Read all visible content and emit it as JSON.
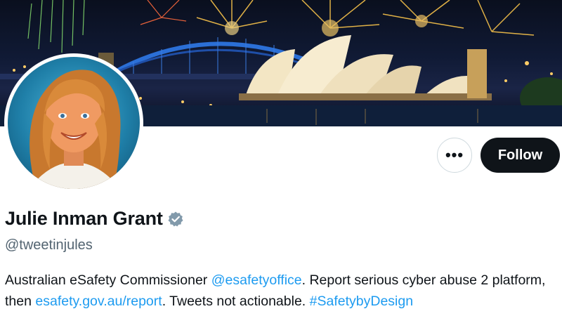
{
  "profile": {
    "display_name": "Julie Inman Grant",
    "handle": "@tweetinjules",
    "verified_icon": "verified-badge-icon",
    "verified_color": "#829aab"
  },
  "actions": {
    "more_label": "•••",
    "more_icon": "more-options-icon",
    "follow_label": "Follow"
  },
  "bio": {
    "text_1": "Australian eSafety Commissioner ",
    "mention": "@esafetyoffice",
    "text_2": ". Report serious cyber abuse 2 platform, then ",
    "link": "esafety.gov.au/report",
    "text_3": ". Tweets not actionable. ",
    "hashtag": "#SafetybyDesign"
  },
  "colors": {
    "accent": "#1d9bf0",
    "text": "#0f1419",
    "secondary": "#536471",
    "follow_bg": "#0f1419"
  }
}
